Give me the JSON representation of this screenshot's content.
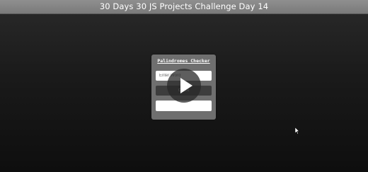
{
  "window": {
    "title": "30 Days 30 JS Projects Challenge Day 14"
  },
  "app": {
    "heading": "Palindromes Checker",
    "input_placeholder": "Enter Word",
    "input_value": "",
    "check_label": "Check",
    "result_text": ""
  },
  "overlay": {
    "icon": "play-icon"
  },
  "colors": {
    "titlebar": "#7f7f7f",
    "card": "#6f6f6f",
    "button": "#3d3d3d",
    "background": "#141414"
  }
}
